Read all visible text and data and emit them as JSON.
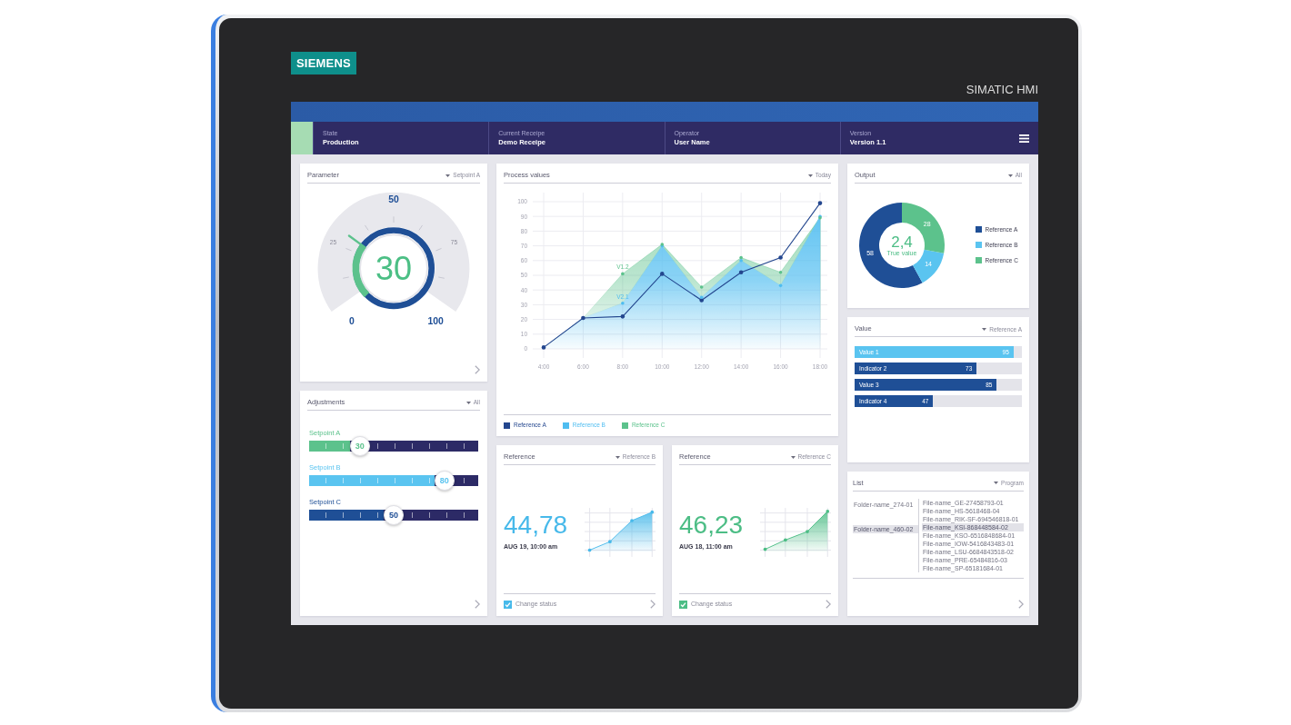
{
  "device": {
    "brand": "SIEMENS",
    "model": "SIMATIC HMI"
  },
  "header": {
    "fields": [
      {
        "label": "State",
        "value": "Production"
      },
      {
        "label": "Current Receipe",
        "value": "Demo Receipe"
      },
      {
        "label": "Operator",
        "value": "User Name"
      },
      {
        "label": "Version",
        "value": "Version 1.1"
      }
    ]
  },
  "parameter": {
    "title": "Parameter",
    "filter": "Setpoint A",
    "gauge": {
      "value": "30",
      "level": 0.3,
      "scale_labels": [
        {
          "text": "0",
          "kind": "major"
        },
        {
          "text": "25",
          "kind": "minor"
        },
        {
          "text": "50",
          "kind": "major"
        },
        {
          "text": "75",
          "kind": "minor"
        },
        {
          "text": "100",
          "kind": "major"
        }
      ]
    }
  },
  "adjustments": {
    "title": "Adjustments",
    "filter": "All",
    "sliders": [
      {
        "label": "Setpoint A",
        "value": "30",
        "level": 0.3,
        "color": "#5cc28c"
      },
      {
        "label": "Setpoint B",
        "value": "80",
        "level": 0.8,
        "color": "#5ac4f0"
      },
      {
        "label": "Setpoint C",
        "value": "50",
        "level": 0.5,
        "color": "#1f4f96"
      }
    ]
  },
  "process_values": {
    "title": "Process values",
    "filter": "Today",
    "chart_data": [
      {
        "type": "line",
        "categories": [
          "4:00",
          "6:00",
          "8:00",
          "10:00",
          "12:00",
          "14:00",
          "16:00",
          "18:00"
        ],
        "ylim": [
          0,
          100
        ],
        "yticks": [
          0,
          10,
          20,
          30,
          40,
          50,
          60,
          70,
          80,
          90,
          100
        ],
        "grid": true,
        "legend": "bottom",
        "annotations": [
          "V1.2",
          "V2.1"
        ],
        "series": [
          {
            "name": "Reference A",
            "type": "line",
            "color": "#23468e",
            "values": [
              1,
              21,
              22,
              51,
              33,
              52,
              62,
              99
            ]
          },
          {
            "name": "Reference B",
            "type": "area",
            "color": "#4fbdf0",
            "values": [
              1,
              21,
              31,
              70,
              35,
              60,
              43,
              90
            ]
          },
          {
            "name": "Reference C",
            "type": "area",
            "color": "#5cc28c",
            "values": [
              1,
              21,
              51,
              71,
              42,
              62,
              52,
              89
            ]
          }
        ]
      }
    ]
  },
  "references": [
    {
      "title": "Reference",
      "filter": "Reference B",
      "value": "44,78",
      "date": "AUG 19, 10:00 am",
      "color": "#47b9ea",
      "checkbox": {
        "label": "Change status",
        "checked": true
      }
    },
    {
      "title": "Reference",
      "filter": "Reference C",
      "value": "46,23",
      "date": "AUG 18, 11:00 am",
      "color": "#4cbd85",
      "checkbox": {
        "label": "Change status",
        "checked": true
      }
    }
  ],
  "output": {
    "title": "Output",
    "filter": "All",
    "center_value": "2,4",
    "center_label": "True value",
    "chart_data": [
      {
        "type": "donut",
        "categories": [
          "Reference A",
          "Reference B",
          "Reference C"
        ],
        "values": [
          58,
          14,
          28
        ],
        "colors": [
          "#1f4f96",
          "#5ac4f0",
          "#5cc28c"
        ],
        "data_labels": true,
        "legend": "right"
      }
    ]
  },
  "value": {
    "title": "Value",
    "filter": "Reference A",
    "bars": [
      {
        "label": "Value 1",
        "value": "95",
        "level": 0.95,
        "color": "#5ac4f0"
      },
      {
        "label": "Indicator 2",
        "value": "73",
        "level": 0.73,
        "color": "#1f4f96"
      },
      {
        "label": "Value 3",
        "value": "85",
        "level": 0.85,
        "color": "#1f4f96"
      },
      {
        "label": "Indicator 4",
        "value": "47",
        "level": 0.47,
        "color": "#1f4f96"
      }
    ]
  },
  "list": {
    "title": "List",
    "filter": "Program",
    "folders": [
      {
        "name": "Folder-name_274-01",
        "selected": false
      },
      {
        "name": "Folder-name_460-02",
        "selected": true
      }
    ],
    "files": [
      {
        "name": "File-name_GE-27458793-01",
        "selected": false
      },
      {
        "name": "File-name_HS-5618468-04",
        "selected": false
      },
      {
        "name": "File-name_RIK-SF-694546818-01",
        "selected": false
      },
      {
        "name": "File-name_KSI-868448584-02",
        "selected": true
      },
      {
        "name": "File-name_KSO-6516848684-01",
        "selected": false
      },
      {
        "name": "File-name_IOW-5416843483-01",
        "selected": false
      },
      {
        "name": "File-name_LSU-6684843518-02",
        "selected": false
      },
      {
        "name": "File-name_PRE-65484816-03",
        "selected": false
      },
      {
        "name": "File-name_SP-65181684-01",
        "selected": false
      }
    ]
  }
}
